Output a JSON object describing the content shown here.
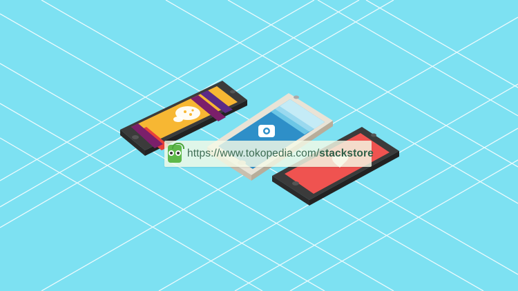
{
  "url_bar": {
    "prefix": "https://www.tokopedia.com/",
    "store": "stackstore",
    "logo_icon": "tokopedia-owl-icon"
  },
  "phones": [
    {
      "name": "phone-left",
      "screen_icon": "lightbulb-brain-icon",
      "screen_color": "#f7b733",
      "stripes": [
        "#7b1f6b",
        "#5b2a86",
        "#e8403a"
      ]
    },
    {
      "name": "phone-center",
      "screen_icon": "camera-app-icon",
      "screen_color": "#2e8fc8"
    },
    {
      "name": "phone-right",
      "screen_icon": "heart-icon",
      "screen_color": "#ef5350"
    }
  ],
  "colors": {
    "background": "#7de1f2",
    "grid_lines": "#ffffff"
  }
}
